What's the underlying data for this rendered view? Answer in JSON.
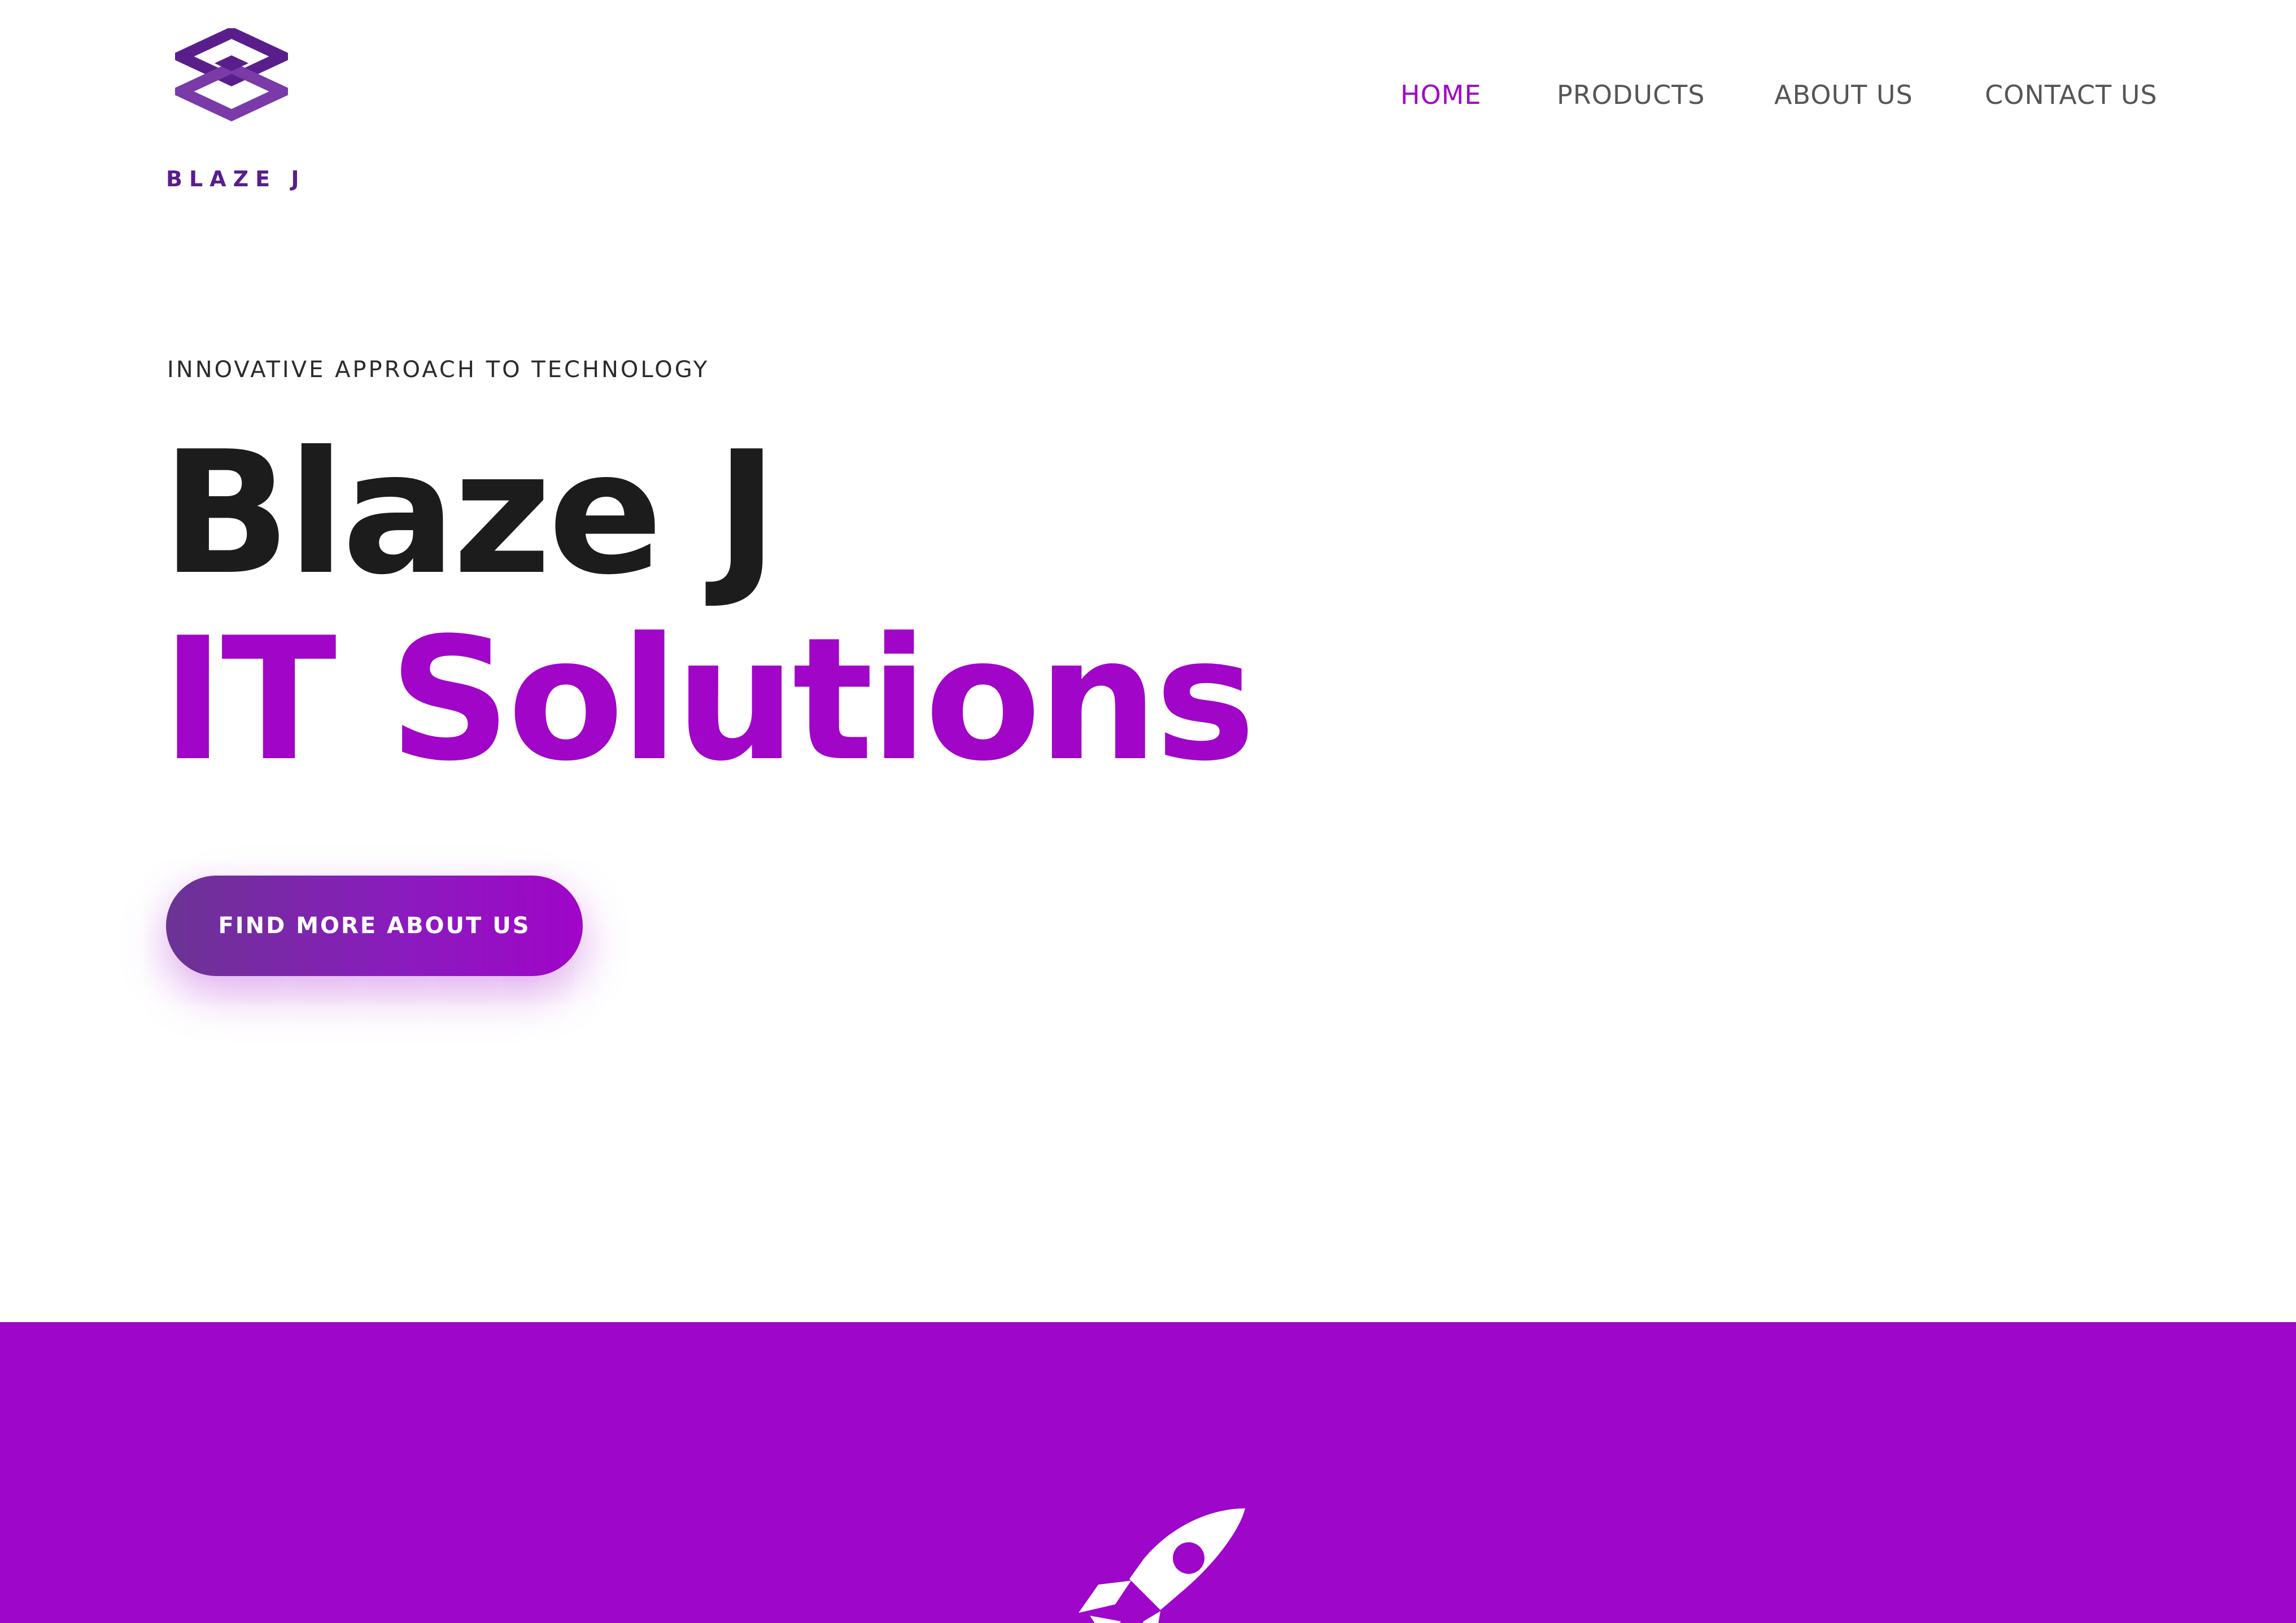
{
  "colors": {
    "accent": "#a005c8",
    "heading_dark": "#1c1c1c",
    "nav_text": "#555555",
    "band_background": "#9e06c9",
    "logo_purple": "#5a1e8c"
  },
  "header": {
    "logo": {
      "icon": "blaze-j-logo-icon",
      "text": "BLAZE J"
    },
    "nav": [
      {
        "label": "HOME",
        "active": true
      },
      {
        "label": "PRODUCTS",
        "active": false
      },
      {
        "label": "ABOUT US",
        "active": false
      },
      {
        "label": "CONTACT US",
        "active": false
      }
    ]
  },
  "hero": {
    "tagline": "INNOVATIVE APPROACH TO TECHNOLOGY",
    "title_line1": "Blaze J",
    "title_line2": "IT Solutions",
    "cta_label": "FIND MORE ABOUT US"
  },
  "band": {
    "icon": "rocket-icon"
  }
}
